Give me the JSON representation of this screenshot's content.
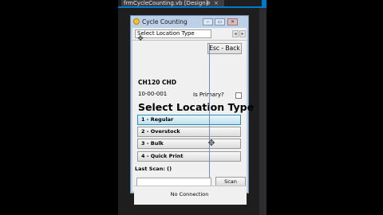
{
  "ide": {
    "document_tab": "frmCycleCounting.vb [Design]",
    "pin_glyph": "⊕",
    "close_glyph": "×"
  },
  "form": {
    "title": "Cycle Counting",
    "minimize_glyph": "–",
    "maximize_glyph": "▭",
    "close_glyph": "✕"
  },
  "tab": {
    "label": "Select Location Type",
    "left_arrow": "◂",
    "right_arrow": "▸"
  },
  "header": {
    "esc_back_label": "Esc - Back"
  },
  "info": {
    "location_code": "CH120 CHD",
    "item_number": "10-00-001",
    "is_primary_label": "Is Primary?",
    "is_primary_checked": false
  },
  "main": {
    "heading": "Select Location Type",
    "options": [
      {
        "label": "1 - Regular"
      },
      {
        "label": "2 - Overstock"
      },
      {
        "label": "3 - Bulk"
      },
      {
        "label": "4 - Quick Print"
      }
    ]
  },
  "scan": {
    "last_scan_label": "Last Scan: ()",
    "input_value": "",
    "button_label": "Scan"
  },
  "status": {
    "text": "No Connection"
  },
  "colors": {
    "ide_background": "#1e1e1e",
    "ide_accent": "#007acc",
    "form_frame": "#bcd0e8",
    "client_background": "#f0f0f0",
    "selected_option": "#bde1ef"
  },
  "icons": {
    "app_icon": "app-icon",
    "move_handle": "move-cross-icon"
  }
}
